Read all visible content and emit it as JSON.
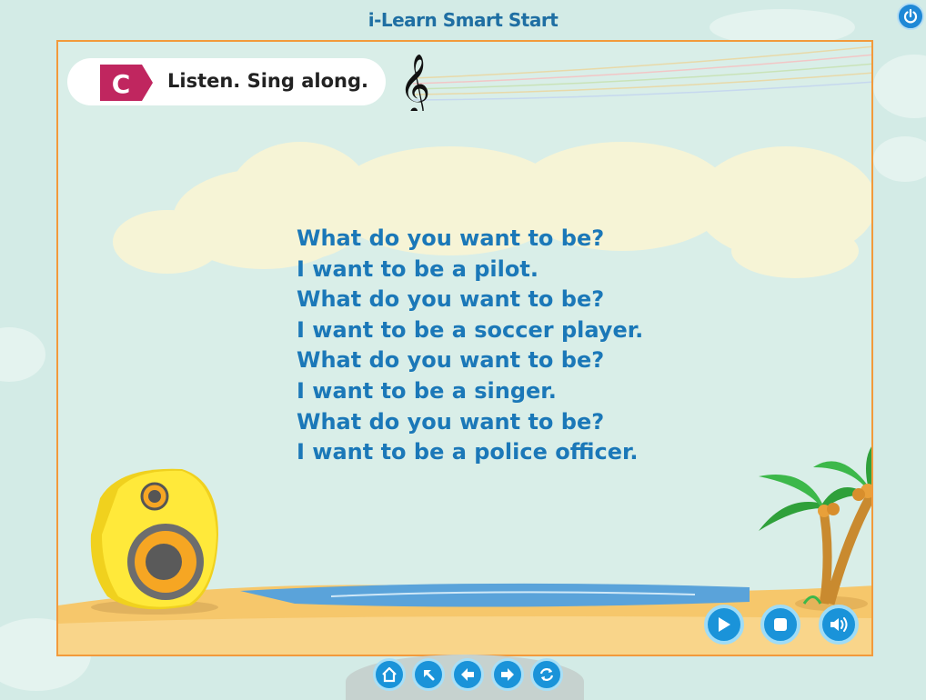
{
  "app": {
    "title": "i-Learn Smart Start"
  },
  "activity": {
    "badge_letter": "C",
    "instruction": "Listen. Sing along."
  },
  "lyrics": [
    "What do you want to be?",
    "I want to be a pilot.",
    "What do you want to be?",
    "I want to be a soccer player.",
    "What do you want to be?",
    "I want to be a singer.",
    "What do you want to be?",
    "I want to be a police officer."
  ],
  "player_controls": [
    {
      "name": "play",
      "icon": "play-icon"
    },
    {
      "name": "stop",
      "icon": "stop-icon"
    },
    {
      "name": "volume",
      "icon": "volume-icon"
    }
  ],
  "navigation": [
    {
      "name": "home",
      "icon": "home-icon"
    },
    {
      "name": "menu",
      "icon": "arrow-up-left-icon"
    },
    {
      "name": "previous",
      "icon": "arrow-left-icon"
    },
    {
      "name": "next",
      "icon": "arrow-right-icon"
    },
    {
      "name": "replay",
      "icon": "refresh-icon"
    }
  ],
  "colors": {
    "accent_blue": "#1a93d9",
    "lyrics_blue": "#1b78b8",
    "frame_orange": "#f29a3b",
    "badge_pink": "#c0265f"
  }
}
